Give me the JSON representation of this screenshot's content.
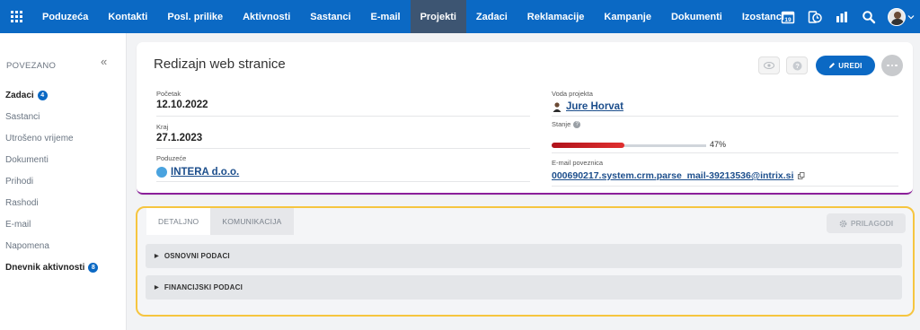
{
  "topnav": {
    "items": [
      "Poduzeća",
      "Kontakti",
      "Posl. prilike",
      "Aktivnosti",
      "Sastanci",
      "E-mail",
      "Projekti",
      "Zadaci",
      "Reklamacije",
      "Kampanje",
      "Dokumenti",
      "Izostanci"
    ],
    "active_index": 6,
    "calendar_day": "19",
    "icons": [
      "apps-grid-icon",
      "calendar-icon",
      "timer-icon",
      "chart-icon",
      "search-icon",
      "avatar",
      "chevron-down-icon"
    ]
  },
  "sidebar": {
    "heading": "POVEZANO",
    "collapse_glyph": "«",
    "items": [
      {
        "label": "Zadaci",
        "badge": "4",
        "bold": true
      },
      {
        "label": "Sastanci",
        "badge": null,
        "bold": false
      },
      {
        "label": "Utrošeno vrijeme",
        "badge": null,
        "bold": false
      },
      {
        "label": "Dokumenti",
        "badge": null,
        "bold": false
      },
      {
        "label": "Prihodi",
        "badge": null,
        "bold": false
      },
      {
        "label": "Rashodi",
        "badge": null,
        "bold": false
      },
      {
        "label": "E-mail",
        "badge": null,
        "bold": false
      },
      {
        "label": "Napomena",
        "badge": null,
        "bold": false
      },
      {
        "label": "Dnevnik aktivnosti",
        "badge": "8",
        "bold": true
      }
    ]
  },
  "card": {
    "title": "Redizajn web stranice",
    "edit_label": "UREDI",
    "start_label": "Početak",
    "start_value": "12.10.2022",
    "end_label": "Kraj",
    "end_value": "27.1.2023",
    "company_label": "Poduzeće",
    "company_value": "INTERA d.o.o.",
    "lead_label": "Voda projekta",
    "lead_value": "Jure Horvat",
    "status_label": "Stanje",
    "status_help": "?",
    "progress_percent": 47,
    "progress_text": "47%",
    "email_label": "E-mail poveznica",
    "email_value": "000690217.system.crm.parse_mail-39213536@intrix.si"
  },
  "tabs": {
    "items": [
      "DETALJNO",
      "KOMUNIKACIJA"
    ],
    "active_index": 0,
    "customize_label": "PRILAGODI"
  },
  "sections": [
    "OSNOVNI PODACI",
    "FINANCIJSKI PODACI"
  ],
  "colors": {
    "brand": "#0b69c4",
    "nav_active": "#3d5572",
    "card_accent": "#8b1f9a",
    "highlight": "#f6c53f",
    "progress": "#d02020"
  }
}
